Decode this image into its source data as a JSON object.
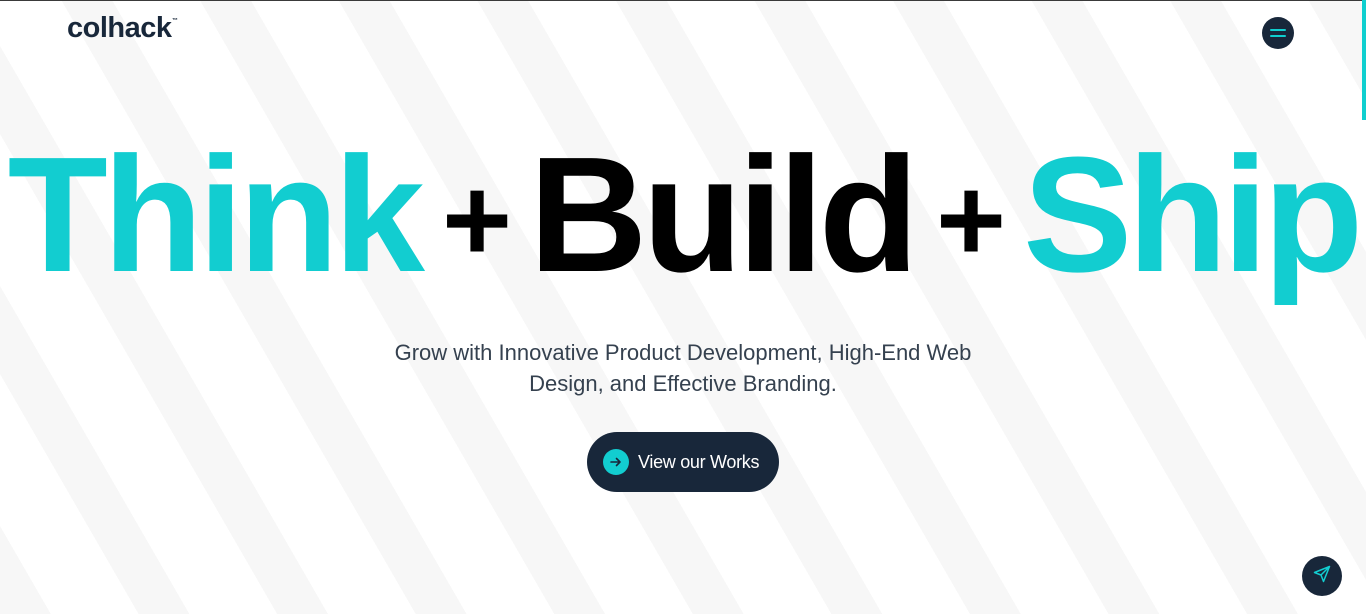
{
  "header": {
    "logo_text": "colhack",
    "logo_tm": "™",
    "menu_icon": "hamburger-menu-icon"
  },
  "hero": {
    "word1": "Think",
    "plus1": "+",
    "word2": "Build",
    "plus2": "+",
    "word3": "Ship"
  },
  "subtitle": {
    "line1": "Grow with Innovative Product Development, High-End Web",
    "line2": "Design, and Effective Branding."
  },
  "cta": {
    "label": "View our Works",
    "icon": "arrow-right-icon"
  },
  "floating": {
    "icon": "send-icon"
  },
  "colors": {
    "accent": "#12cdd0",
    "dark": "#18273a",
    "text": "#35414f"
  }
}
